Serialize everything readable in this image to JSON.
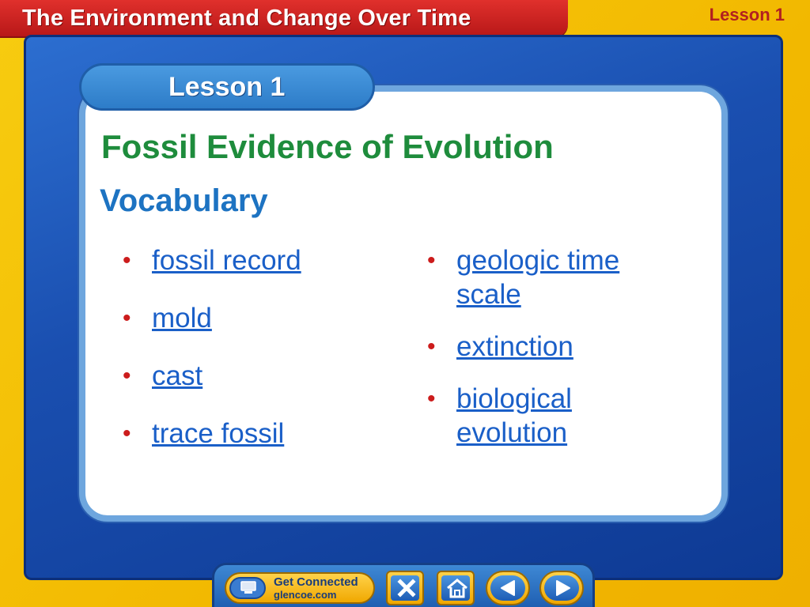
{
  "header": {
    "title": "The Environment and Change Over Time",
    "lesson_corner": "Lesson 1"
  },
  "card": {
    "lesson_tab": "Lesson 1",
    "title": "Fossil Evidence of Evolution",
    "vocab_heading": "Vocabulary"
  },
  "vocabulary": {
    "left": [
      "fossil record",
      "mold",
      "cast",
      "trace fossil"
    ],
    "right": [
      "geologic time scale",
      "extinction",
      "biological evolution"
    ]
  },
  "nav": {
    "get_connected_title": "Get Connected",
    "get_connected_sub": "glencoe.com",
    "close_icon": "close-icon",
    "home_icon": "home-icon",
    "prev_icon": "arrow-left-icon",
    "next_icon": "arrow-right-icon"
  },
  "colors": {
    "header_red": "#c82020",
    "frame_yellow": "#f5c400",
    "panel_blue": "#1a4fb0",
    "title_green": "#1e8c3c",
    "vocab_blue": "#1d73c2",
    "link_blue": "#1a5fc8",
    "bullet_red": "#cc1c1c"
  }
}
